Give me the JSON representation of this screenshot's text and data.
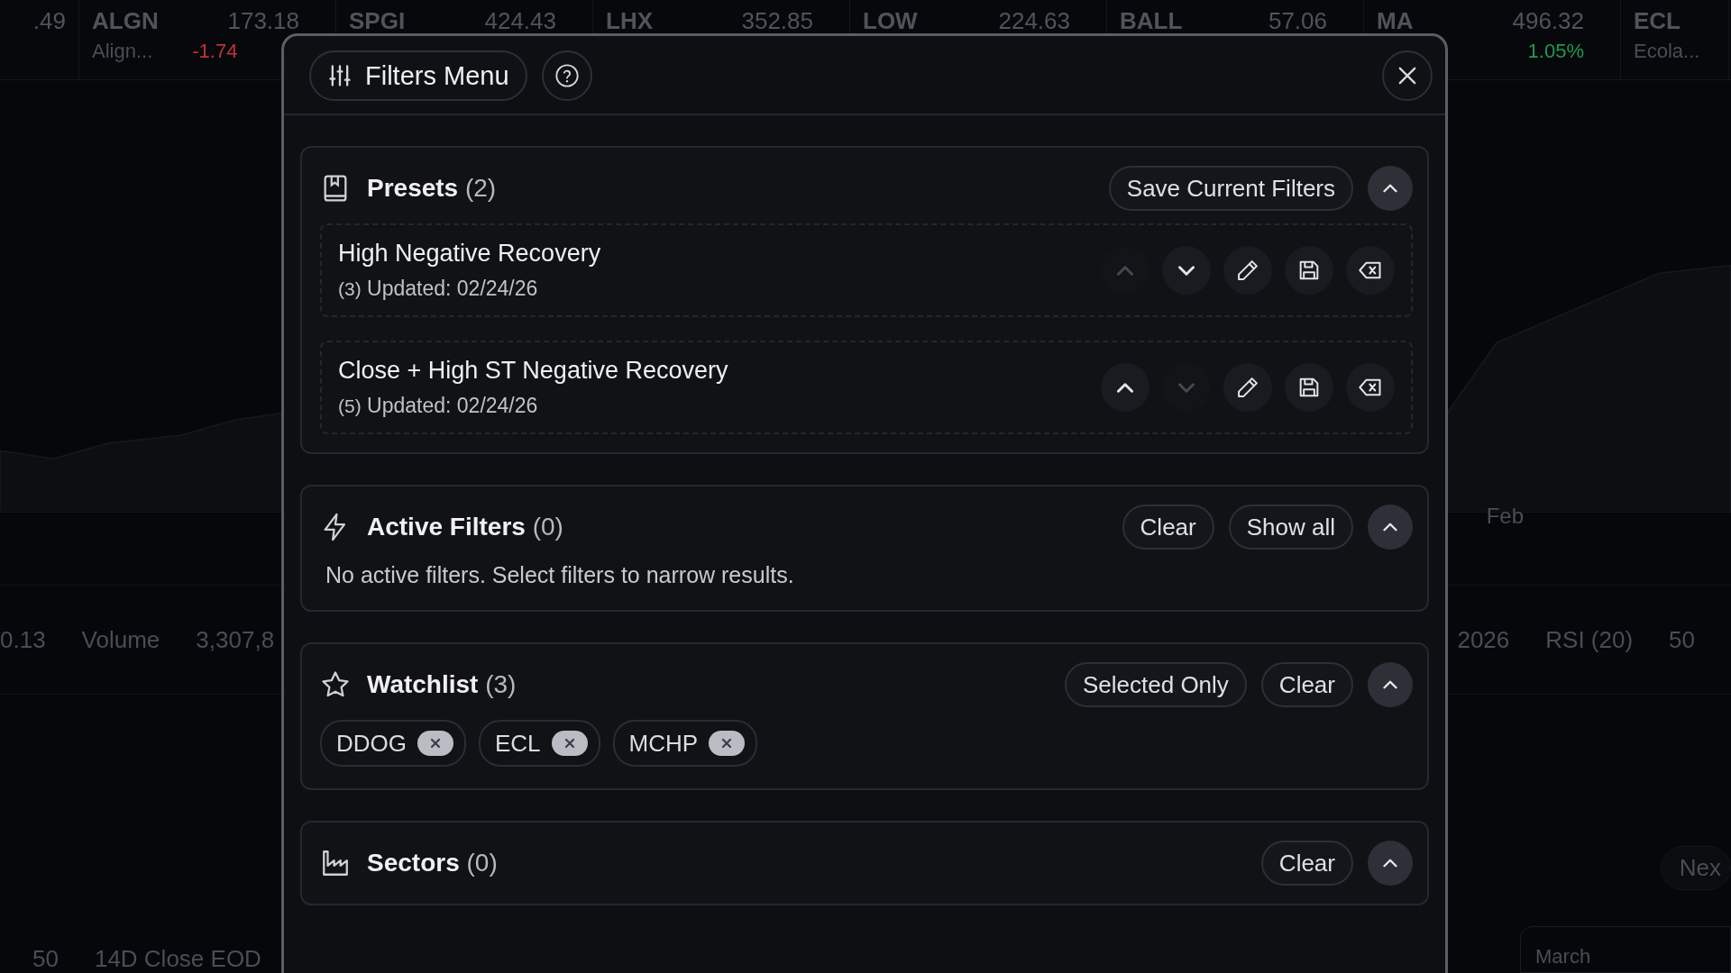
{
  "ticker": [
    {
      "price": ".49"
    },
    {
      "symbol": "ALGN",
      "price": "173.18",
      "name": "Align...",
      "change": "-1.74",
      "color": "#c0323c"
    },
    {
      "symbol": "SPGI",
      "price": "424.43"
    },
    {
      "symbol": "LHX",
      "price": "352.85"
    },
    {
      "symbol": "LOW",
      "price": "224.63"
    },
    {
      "symbol": "BALL",
      "price": "57.06"
    },
    {
      "symbol": "MA",
      "price": "496.32",
      "change": "1.05%",
      "color": "#1f9a52"
    },
    {
      "symbol": "ECL",
      "name": "Ecola..."
    }
  ],
  "background": {
    "right_axis_label": "Feb",
    "left_stats": [
      "0.13",
      "Volume",
      "3,307,8"
    ],
    "right_stats": [
      "2026",
      "RSI (20)",
      "50"
    ],
    "left_footer": [
      "50",
      "14D Close EOD"
    ],
    "next_button": "Nex",
    "month_field": "March"
  },
  "modal": {
    "title": "Filters Menu",
    "presets": {
      "title": "Presets",
      "count": "(2)",
      "expanded": true,
      "save_button": "Save Current Filters",
      "items": [
        {
          "name": "High Negative Recovery",
          "count": "(3)",
          "updated_label": "Updated:",
          "date": "02/24/26",
          "up_disabled": true,
          "down_disabled": false
        },
        {
          "name": "Close + High ST Negative Recovery",
          "count": "(5)",
          "updated_label": "Updated:",
          "date": "02/24/26",
          "up_disabled": false,
          "down_disabled": true
        }
      ]
    },
    "active_filters": {
      "title": "Active Filters",
      "count": "(0)",
      "expanded": true,
      "buttons": [
        "Clear",
        "Show all"
      ],
      "empty_text": "No active filters. Select filters to narrow results."
    },
    "watchlist": {
      "title": "Watchlist",
      "count": "(3)",
      "expanded": true,
      "buttons": [
        "Selected Only",
        "Clear"
      ],
      "chips": [
        "DDOG",
        "ECL",
        "MCHP"
      ]
    },
    "sectors": {
      "title": "Sectors",
      "count": "(0)",
      "expanded": true,
      "buttons": [
        "Clear"
      ]
    }
  }
}
